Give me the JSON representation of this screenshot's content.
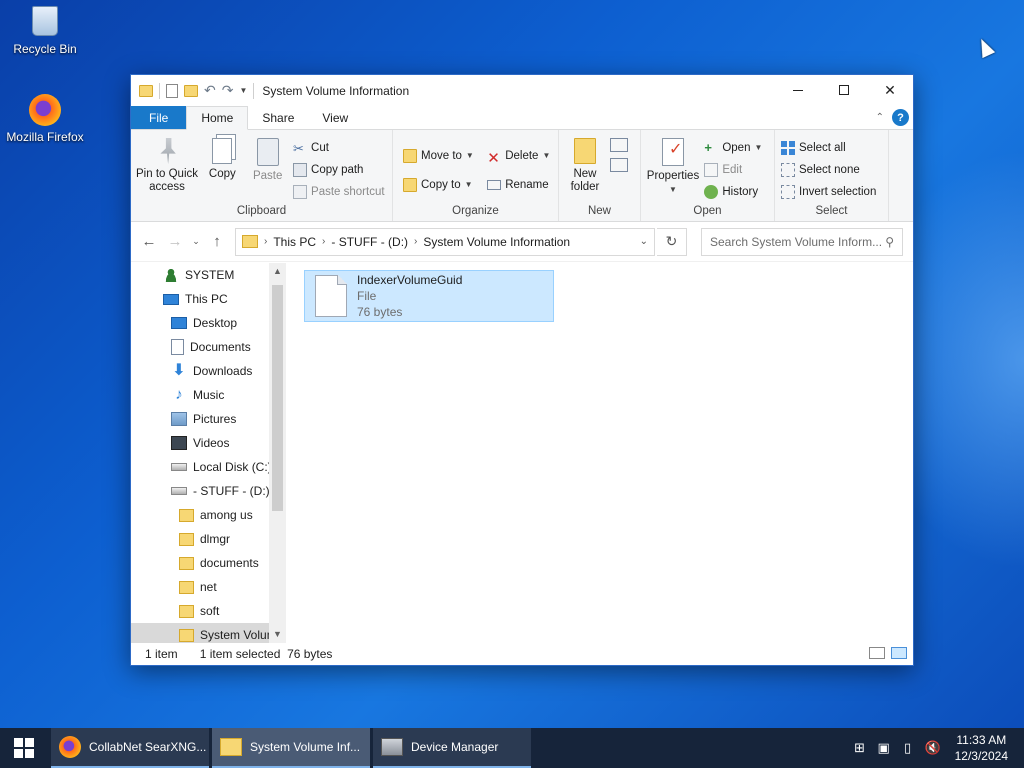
{
  "desktop": {
    "icons": [
      {
        "label": "Recycle Bin",
        "icon": "recycle-bin-icon"
      },
      {
        "label": "Mozilla Firefox",
        "icon": "firefox-icon"
      }
    ]
  },
  "window": {
    "title": "System Volume Information",
    "tabs": [
      "File",
      "Home",
      "Share",
      "View"
    ],
    "active_tab": "Home",
    "ribbon": {
      "clipboard": {
        "label": "Clipboard",
        "pin": "Pin to Quick access",
        "copy": "Copy",
        "paste": "Paste",
        "cut": "Cut",
        "copy_path": "Copy path",
        "paste_shortcut": "Paste shortcut"
      },
      "organize": {
        "label": "Organize",
        "move_to": "Move to",
        "copy_to": "Copy to",
        "delete": "Delete",
        "rename": "Rename"
      },
      "new": {
        "label": "New",
        "new_folder": "New folder"
      },
      "open": {
        "label": "Open",
        "properties": "Properties",
        "open": "Open",
        "edit": "Edit",
        "history": "History"
      },
      "select": {
        "label": "Select",
        "select_all": "Select all",
        "select_none": "Select none",
        "invert": "Invert selection"
      }
    },
    "address": {
      "crumbs": [
        "This PC",
        "- STUFF - (D:)",
        "System Volume Information"
      ],
      "search_placeholder": "Search System Volume Inform..."
    },
    "nav": [
      {
        "label": "SYSTEM",
        "icon": "user-icon",
        "indent": 0
      },
      {
        "label": "This PC",
        "icon": "this-pc-icon",
        "indent": 0
      },
      {
        "label": "Desktop",
        "icon": "desktop-icon",
        "indent": 1
      },
      {
        "label": "Documents",
        "icon": "documents-icon",
        "indent": 1
      },
      {
        "label": "Downloads",
        "icon": "downloads-icon",
        "indent": 1
      },
      {
        "label": "Music",
        "icon": "music-icon",
        "indent": 1
      },
      {
        "label": "Pictures",
        "icon": "pictures-icon",
        "indent": 1
      },
      {
        "label": "Videos",
        "icon": "videos-icon",
        "indent": 1
      },
      {
        "label": "Local Disk (C:)",
        "icon": "disk-icon",
        "indent": 1
      },
      {
        "label": "- STUFF - (D:)",
        "icon": "disk-icon",
        "indent": 1
      },
      {
        "label": "among us",
        "icon": "folder-icon",
        "indent": 2
      },
      {
        "label": "dlmgr",
        "icon": "folder-icon",
        "indent": 2
      },
      {
        "label": "documents",
        "icon": "folder-icon",
        "indent": 2
      },
      {
        "label": "net",
        "icon": "folder-icon",
        "indent": 2
      },
      {
        "label": "soft",
        "icon": "folder-icon",
        "indent": 2
      },
      {
        "label": "System Volun",
        "icon": "folder-icon",
        "indent": 2
      }
    ],
    "file": {
      "name": "IndexerVolumeGuid",
      "type": "File",
      "size": "76 bytes"
    },
    "status": {
      "count": "1 item",
      "selected": "1 item selected  76 bytes"
    }
  },
  "taskbar": {
    "buttons": [
      {
        "label": "CollabNet SearXNG...",
        "icon": "firefox-icon"
      },
      {
        "label": "System Volume Inf...",
        "icon": "folder-icon"
      },
      {
        "label": "Device Manager",
        "icon": "device-manager-icon"
      }
    ],
    "time": "11:33 AM",
    "date": "12/3/2024"
  }
}
